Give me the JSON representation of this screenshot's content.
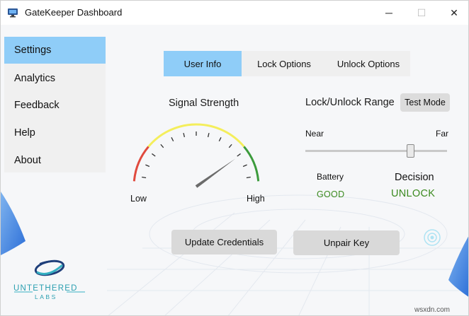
{
  "window": {
    "title": "GateKeeper Dashboard",
    "controls": {
      "minimize": "─",
      "maximize": "☐",
      "close": "✕"
    }
  },
  "sidebar": {
    "items": [
      {
        "label": "Settings",
        "active": true
      },
      {
        "label": "Analytics",
        "active": false
      },
      {
        "label": "Feedback",
        "active": false
      },
      {
        "label": "Help",
        "active": false
      },
      {
        "label": "About",
        "active": false
      }
    ]
  },
  "tabs": [
    {
      "label": "User Info",
      "active": true
    },
    {
      "label": "Lock Options",
      "active": false
    },
    {
      "label": "Unlock Options",
      "active": false
    }
  ],
  "signal": {
    "title": "Signal Strength",
    "low_label": "Low",
    "high_label": "High",
    "needle_fraction": 0.82,
    "zone_colors": {
      "low": "#e04a3e",
      "mid": "#f4ee5c",
      "high": "#3c9b3c"
    }
  },
  "range": {
    "title": "Lock/Unlock Range",
    "test_mode_label": "Test Mode",
    "near_label": "Near",
    "far_label": "Far",
    "slider_fraction": 0.74
  },
  "status": {
    "battery_label": "Battery",
    "battery_value": "GOOD",
    "decision_label": "Decision",
    "decision_value": "UNLOCK",
    "ok_color": "#3b8a1f"
  },
  "actions": {
    "update_label": "Update Credentials",
    "unpair_label": "Unpair Key"
  },
  "brand": {
    "line1": "UNTETHERED",
    "line2": "LABS",
    "color": "#2a9fb0"
  },
  "watermark": "wsxdn.com",
  "accent_color": "#8fcdf8"
}
